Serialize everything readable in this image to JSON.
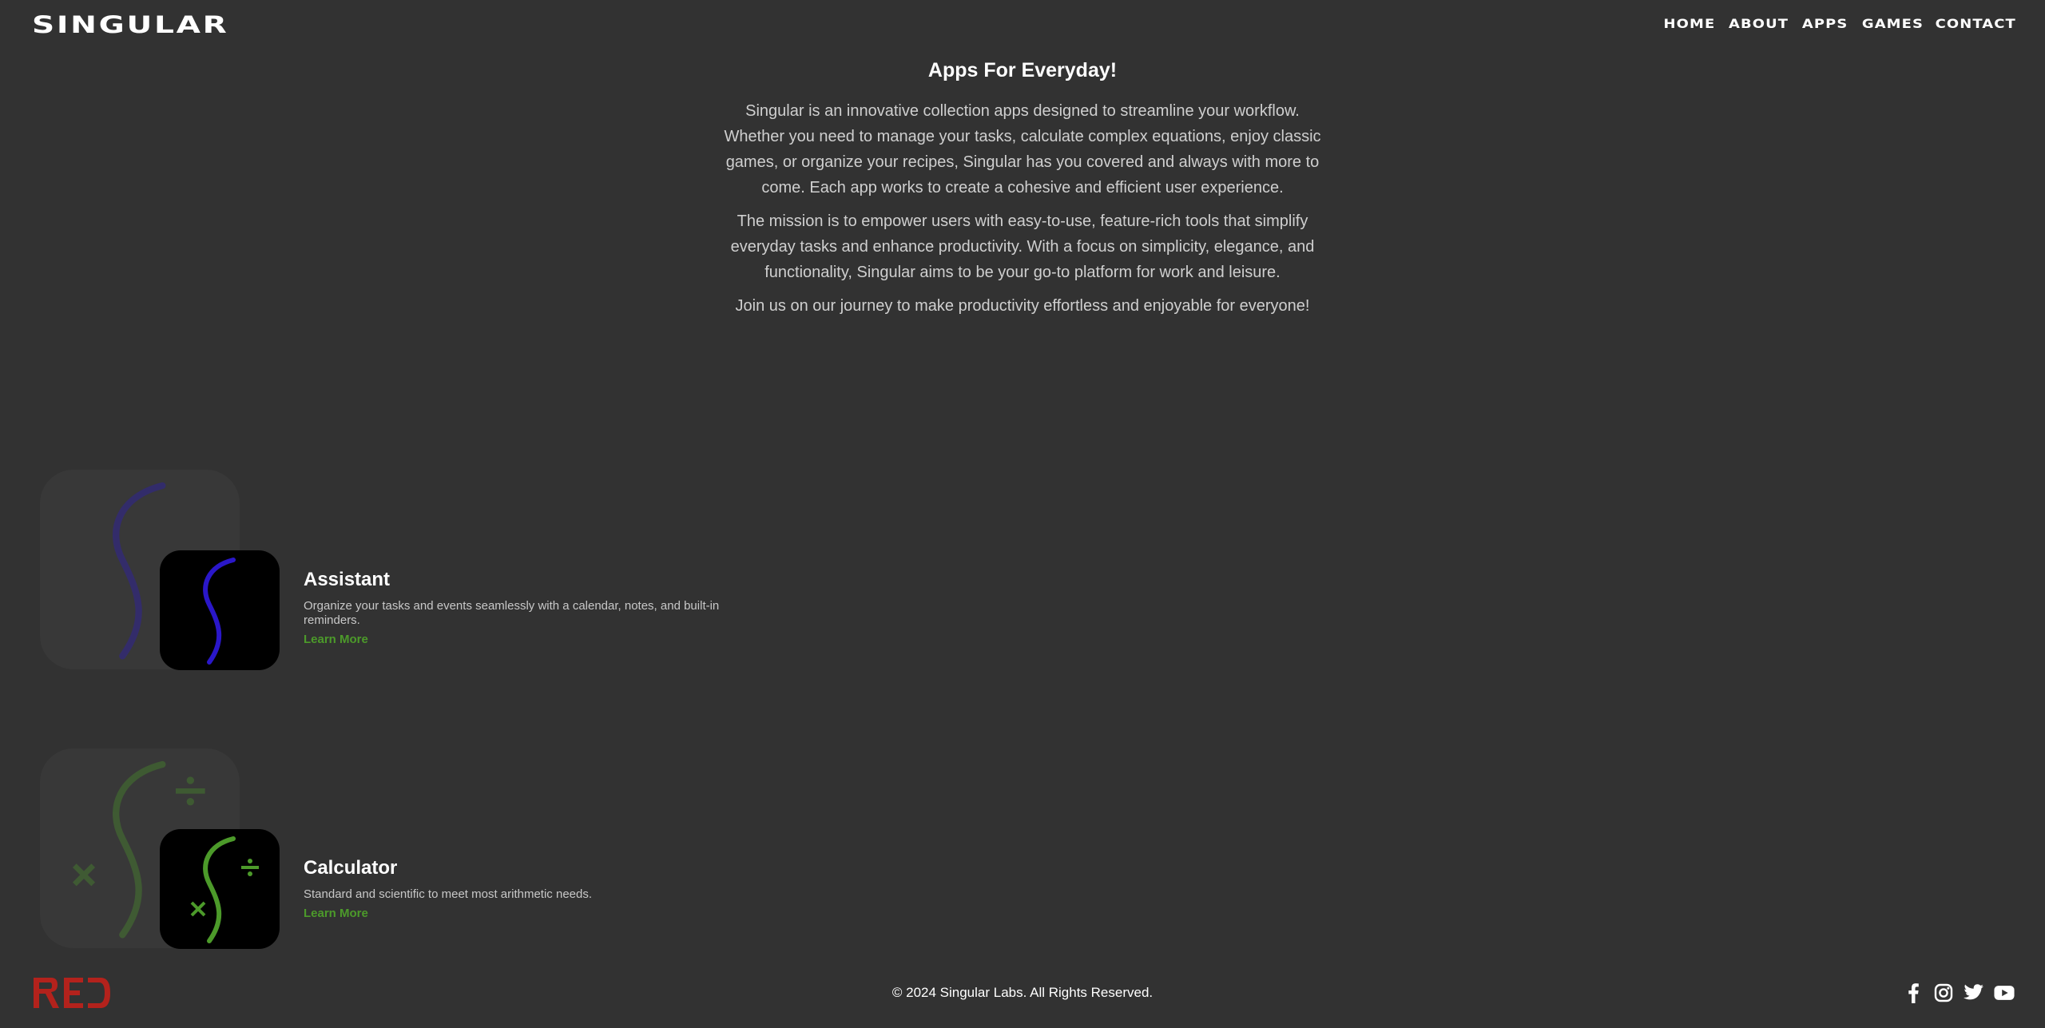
{
  "header": {
    "logo": "SINGULAR",
    "nav": [
      "HOME",
      "ABOUT",
      "APPS",
      "GAMES",
      "CONTACT"
    ]
  },
  "intro": {
    "title": "Apps For Everyday!",
    "paragraphs": [
      "Singular is an innovative collection apps designed to streamline your workflow. Whether you need to manage your tasks, calculate complex equations, enjoy classic games, or organize your recipes, Singular has you covered and always with more to come. Each app works to create a cohesive and efficient user experience.",
      "The mission is to empower users with easy-to-use, feature-rich tools that simplify everyday tasks and enhance productivity. With a focus on simplicity, elegance, and functionality, Singular aims to be your go-to platform for work and leisure.",
      "Join us on our journey to make productivity effortless and enjoyable for everyone!"
    ]
  },
  "apps": [
    {
      "name": "Assistant",
      "description": "Organize your tasks and events seamlessly with a calendar, notes, and built-in reminders.",
      "link": "Learn More",
      "icon": "assistant-s-icon",
      "accent": "#2a17c9"
    },
    {
      "name": "Calculator",
      "description": "Standard and scientific to meet most arithmetic needs.",
      "link": "Learn More",
      "icon": "calculator-s-icon",
      "accent": "#4c9a2a"
    }
  ],
  "footer": {
    "logo": "RED",
    "copyright": "© 2024 Singular Labs. All Rights Reserved.",
    "social": [
      "facebook-icon",
      "instagram-icon",
      "twitter-icon",
      "youtube-icon"
    ]
  },
  "colors": {
    "background": "#323232",
    "link_green": "#4c9a2a",
    "red_logo": "#b3221c"
  }
}
